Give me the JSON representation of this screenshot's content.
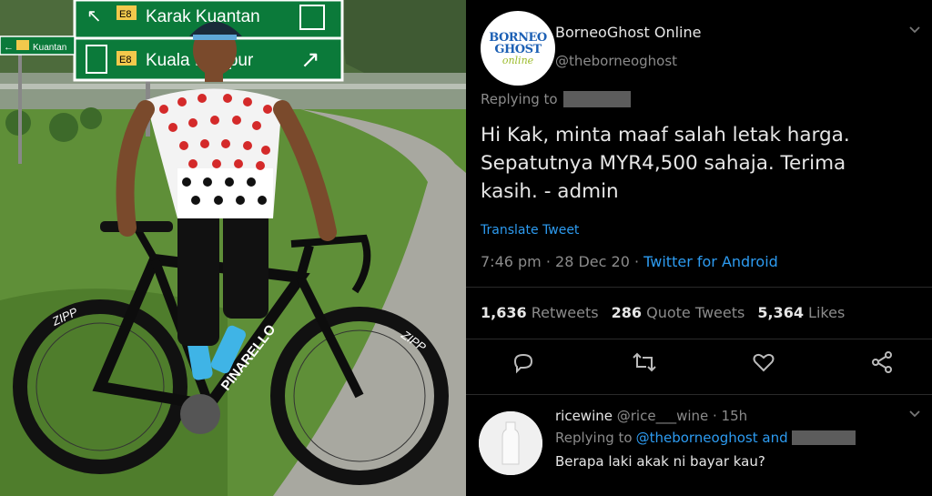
{
  "photo": {
    "sign_top": "Karak Kuantan",
    "sign_bottom": "Kuala Lumpur",
    "sign_code": "E8",
    "small_sign": "Kuantan",
    "bike_brand": "PINARELLO",
    "rim_text": "ZIPP"
  },
  "tweet": {
    "avatar_line1": "BORNEO",
    "avatar_line2": "GHOST",
    "avatar_line3": "online",
    "display_name": "BorneoGhost Online",
    "handle": "@theborneoghost",
    "replying_to": "Replying to",
    "body_lines": [
      "Hi Kak, minta maaf salah letak harga.",
      "Sepatutnya MYR4,500 sahaja. Terima",
      "kasih. - admin"
    ],
    "translate": "Translate Tweet",
    "timestamp": "7:46 pm · 28 Dec 20 ·",
    "source": "Twitter for Android",
    "stats": {
      "retweets_count": "1,636",
      "retweets_label": "Retweets",
      "quotes_count": "286",
      "quotes_label": "Quote Tweets",
      "likes_count": "5,364",
      "likes_label": "Likes"
    },
    "icons": [
      "reply-icon",
      "retweet-icon",
      "like-icon",
      "share-icon"
    ]
  },
  "reply": {
    "name": "ricewine",
    "meta": "@rice___wine · 15h",
    "replying_prefix": "Replying to",
    "replying_link": "@theborneoghost and",
    "text": "Berapa laki akak ni bayar kau?"
  },
  "colors": {
    "link": "#2d9bf0",
    "muted": "#8b8b8b",
    "background": "#000000"
  }
}
